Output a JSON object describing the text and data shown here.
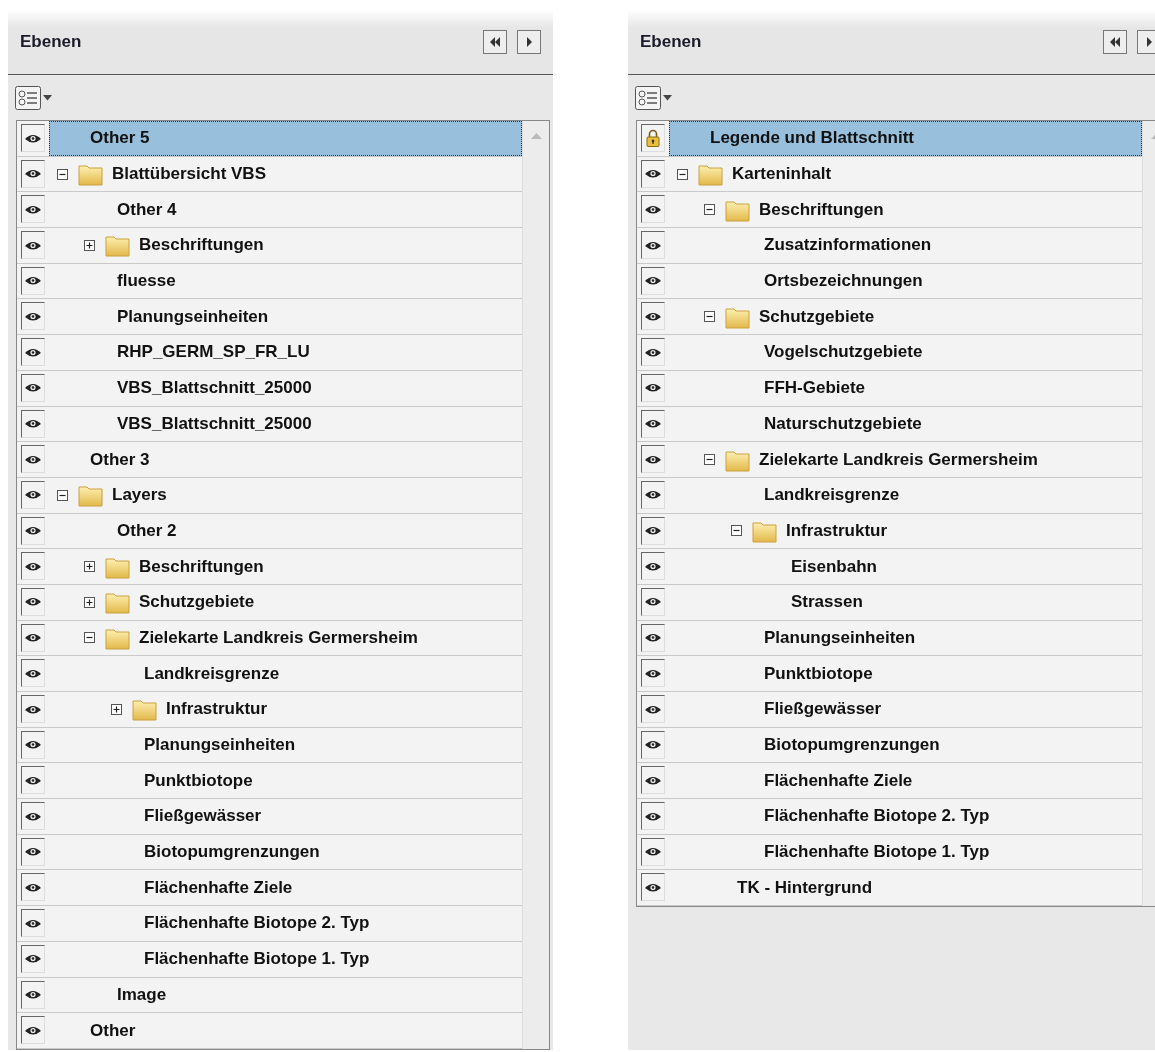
{
  "panels": [
    {
      "title": "Ebenen",
      "layers": [
        {
          "label": "Other 5",
          "kind": "layer",
          "locked": false,
          "selected": true
        },
        {
          "label": "Blattübersicht VBS",
          "kind": "folder",
          "locked": false,
          "selected": false,
          "expanded": true,
          "children": [
            {
              "label": "Other 4",
              "kind": "layer",
              "locked": false,
              "selected": false
            },
            {
              "label": "Beschriftungen",
              "kind": "folder",
              "locked": false,
              "selected": false,
              "expanded": false
            },
            {
              "label": "fluesse",
              "kind": "layer",
              "locked": false,
              "selected": false
            },
            {
              "label": "Planungseinheiten",
              "kind": "layer",
              "locked": false,
              "selected": false
            },
            {
              "label": "RHP_GERM_SP_FR_LU",
              "kind": "layer",
              "locked": false,
              "selected": false
            },
            {
              "label": "VBS_Blattschnitt_25000",
              "kind": "layer",
              "locked": false,
              "selected": false
            },
            {
              "label": "VBS_Blattschnitt_25000",
              "kind": "layer",
              "locked": false,
              "selected": false
            }
          ]
        },
        {
          "label": "Other 3",
          "kind": "layer",
          "locked": false,
          "selected": false
        },
        {
          "label": "Layers",
          "kind": "folder",
          "locked": false,
          "selected": false,
          "expanded": true,
          "children": [
            {
              "label": "Other 2",
              "kind": "layer",
              "locked": false,
              "selected": false
            },
            {
              "label": "Beschriftungen",
              "kind": "folder",
              "locked": false,
              "selected": false,
              "expanded": false
            },
            {
              "label": "Schutzgebiete",
              "kind": "folder",
              "locked": false,
              "selected": false,
              "expanded": false
            },
            {
              "label": "Zielekarte Landkreis Germersheim",
              "kind": "folder",
              "locked": false,
              "selected": false,
              "expanded": true,
              "children": [
                {
                  "label": "Landkreisgrenze",
                  "kind": "layer",
                  "locked": false,
                  "selected": false
                },
                {
                  "label": "Infrastruktur",
                  "kind": "folder",
                  "locked": false,
                  "selected": false,
                  "expanded": false
                },
                {
                  "label": "Planungseinheiten",
                  "kind": "layer",
                  "locked": false,
                  "selected": false
                },
                {
                  "label": "Punktbiotope",
                  "kind": "layer",
                  "locked": false,
                  "selected": false
                },
                {
                  "label": "Fließgewässer",
                  "kind": "layer",
                  "locked": false,
                  "selected": false
                },
                {
                  "label": "Biotopumgrenzungen",
                  "kind": "layer",
                  "locked": false,
                  "selected": false
                },
                {
                  "label": "Flächenhafte Ziele",
                  "kind": "layer",
                  "locked": false,
                  "selected": false
                },
                {
                  "label": "Flächenhafte Biotope 2. Typ",
                  "kind": "layer",
                  "locked": false,
                  "selected": false
                },
                {
                  "label": "Flächenhafte Biotope 1. Typ",
                  "kind": "layer",
                  "locked": false,
                  "selected": false
                }
              ]
            },
            {
              "label": "Image",
              "kind": "layer",
              "locked": false,
              "selected": false
            }
          ]
        },
        {
          "label": "Other",
          "kind": "layer",
          "locked": false,
          "selected": false
        }
      ]
    },
    {
      "title": "Ebenen",
      "layers": [
        {
          "label": "Legende und Blattschnitt",
          "kind": "layer",
          "locked": true,
          "selected": true
        },
        {
          "label": "Karteninhalt",
          "kind": "folder",
          "locked": false,
          "selected": false,
          "expanded": true,
          "children": [
            {
              "label": "Beschriftungen",
              "kind": "folder",
              "locked": false,
              "selected": false,
              "expanded": true,
              "children": [
                {
                  "label": "Zusatzinformationen",
                  "kind": "layer",
                  "locked": false,
                  "selected": false
                },
                {
                  "label": "Ortsbezeichnungen",
                  "kind": "layer",
                  "locked": false,
                  "selected": false
                }
              ]
            },
            {
              "label": "Schutzgebiete",
              "kind": "folder",
              "locked": false,
              "selected": false,
              "expanded": true,
              "children": [
                {
                  "label": "Vogelschutzgebiete",
                  "kind": "layer",
                  "locked": false,
                  "selected": false
                },
                {
                  "label": "FFH-Gebiete",
                  "kind": "layer",
                  "locked": false,
                  "selected": false
                },
                {
                  "label": "Naturschutzgebiete",
                  "kind": "layer",
                  "locked": false,
                  "selected": false
                }
              ]
            },
            {
              "label": "Zielekarte Landkreis Germersheim",
              "kind": "folder",
              "locked": false,
              "selected": false,
              "expanded": true,
              "children": [
                {
                  "label": "Landkreisgrenze",
                  "kind": "layer",
                  "locked": false,
                  "selected": false
                },
                {
                  "label": "Infrastruktur",
                  "kind": "folder",
                  "locked": false,
                  "selected": false,
                  "expanded": true,
                  "children": [
                    {
                      "label": "Eisenbahn",
                      "kind": "layer",
                      "locked": false,
                      "selected": false
                    },
                    {
                      "label": "Strassen",
                      "kind": "layer",
                      "locked": false,
                      "selected": false
                    }
                  ]
                },
                {
                  "label": "Planungseinheiten",
                  "kind": "layer",
                  "locked": false,
                  "selected": false
                },
                {
                  "label": "Punktbiotope",
                  "kind": "layer",
                  "locked": false,
                  "selected": false
                },
                {
                  "label": "Fließgewässer",
                  "kind": "layer",
                  "locked": false,
                  "selected": false
                },
                {
                  "label": "Biotopumgrenzungen",
                  "kind": "layer",
                  "locked": false,
                  "selected": false
                },
                {
                  "label": "Flächenhafte Ziele",
                  "kind": "layer",
                  "locked": false,
                  "selected": false
                },
                {
                  "label": "Flächenhafte Biotope 2. Typ",
                  "kind": "layer",
                  "locked": false,
                  "selected": false
                },
                {
                  "label": "Flächenhafte Biotope 1. Typ",
                  "kind": "layer",
                  "locked": false,
                  "selected": false
                }
              ]
            },
            {
              "label": "TK - Hintergrund",
              "kind": "layer",
              "locked": false,
              "selected": false
            }
          ]
        }
      ]
    }
  ]
}
